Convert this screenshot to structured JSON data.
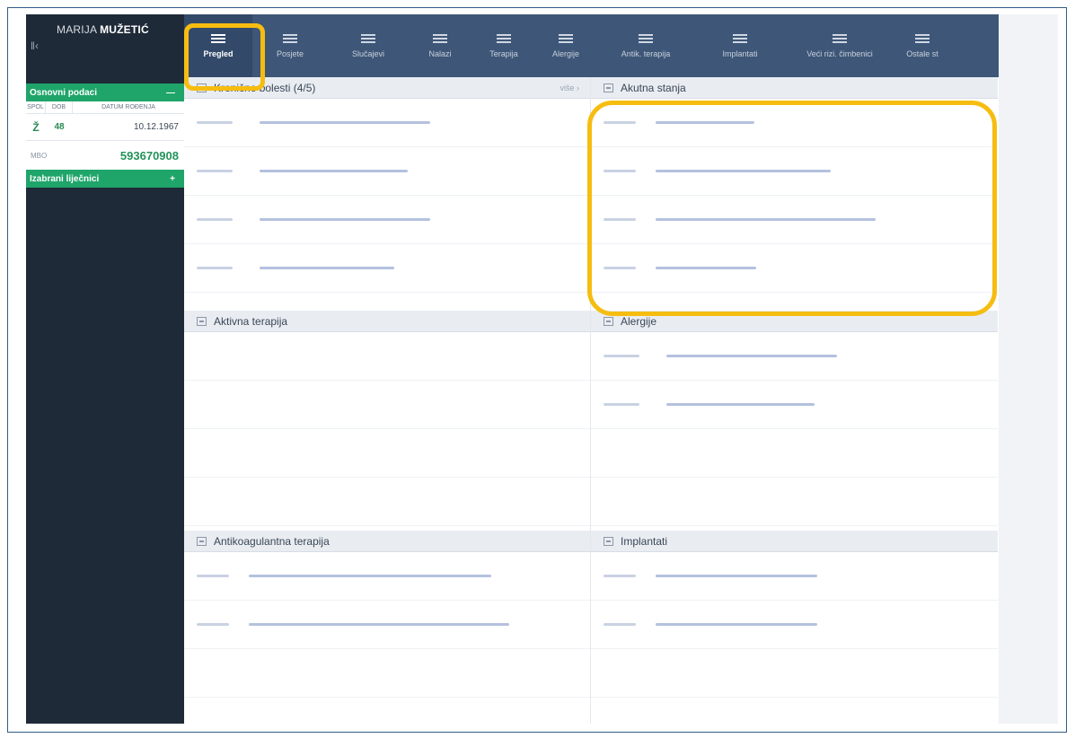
{
  "patient": {
    "first_name": "MARIJA",
    "last_name": "MUŽETIĆ"
  },
  "sidebar": {
    "basic_section": "Osnovni podaci",
    "basic_toggle": "—",
    "columns": [
      "SPOL",
      "DOB",
      "DATUM ROĐENJA"
    ],
    "values": {
      "sex": "Ž",
      "age": "48",
      "birth_date": "10.12.1967"
    },
    "mbo_label": "MBO",
    "mbo_value": "593670908",
    "doctors_section": "Izabrani liječnici",
    "doctors_toggle": "+"
  },
  "nav": {
    "tabs": [
      {
        "label": "Pregled",
        "active": true
      },
      {
        "label": "Posjete",
        "active": false
      },
      {
        "label": "Slučajevi",
        "active": false
      },
      {
        "label": "Nalazi",
        "active": false
      },
      {
        "label": "Terapija",
        "active": false
      },
      {
        "label": "Alergije",
        "active": false
      },
      {
        "label": "Antik. terapija",
        "active": false
      },
      {
        "label": "Implantati",
        "active": false
      },
      {
        "label": "Veći rizi. čimbenici",
        "active": false
      },
      {
        "label": "Ostale st",
        "active": false
      }
    ]
  },
  "panels": {
    "chronic": {
      "title": "Kronične bolesti (4/5)",
      "more": "više ›"
    },
    "acute": {
      "title": "Akutna stanja"
    },
    "active_therapy": {
      "title": "Aktivna terapija"
    },
    "allergies": {
      "title": "Alergije"
    },
    "anticoag": {
      "title": "Antikoagulantna terapija"
    },
    "implants": {
      "title": "Implantati"
    }
  },
  "colors": {
    "highlight": "#f6bd11",
    "nav_bg": "#3e5677",
    "sidebar_bg": "#1f2a38",
    "green": "#1fa56a"
  }
}
